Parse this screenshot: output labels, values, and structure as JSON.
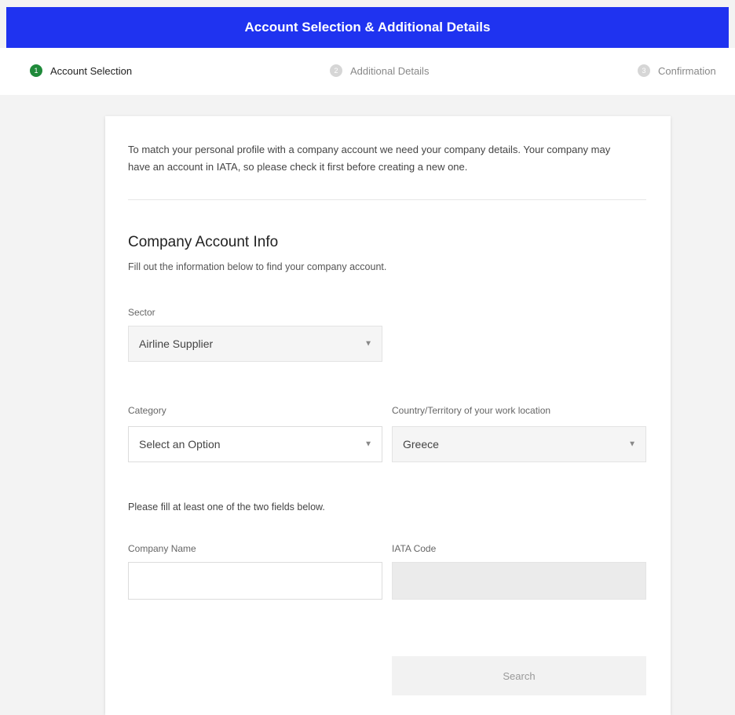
{
  "header": {
    "title": "Account Selection & Additional Details"
  },
  "steps": [
    {
      "number": "1",
      "label": "Account Selection",
      "active": true
    },
    {
      "number": "2",
      "label": "Additional Details",
      "active": false
    },
    {
      "number": "3",
      "label": "Confirmation",
      "active": false
    }
  ],
  "intro": "To match your personal profile with a company account we need your company details. Your company may have an account in IATA, so please check it first before creating a new one.",
  "section": {
    "title": "Company Account Info",
    "subtitle": "Fill out the information below to find your company account."
  },
  "fields": {
    "sector": {
      "label": "Sector",
      "value": "Airline Supplier"
    },
    "category": {
      "label": "Category",
      "value": "Select an Option"
    },
    "country": {
      "label": "Country/Territory of your work location",
      "value": "Greece"
    },
    "note": "Please fill at least one of the two fields below.",
    "company_name": {
      "label": "Company Name",
      "value": ""
    },
    "iata_code": {
      "label": "IATA Code",
      "value": ""
    }
  },
  "search_button": "Search",
  "colors": {
    "header": "#1f33f0",
    "active_step": "#1f8a3a"
  }
}
